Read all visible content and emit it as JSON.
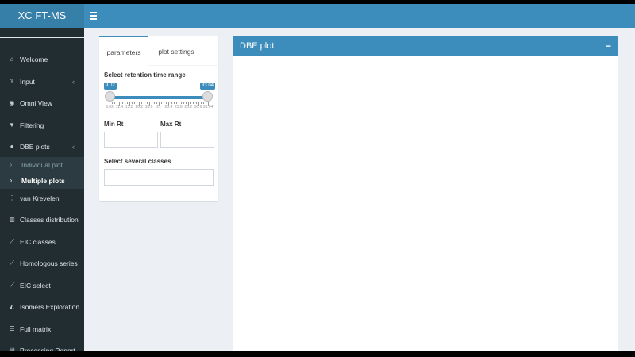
{
  "app": {
    "title": "XC FT-MS"
  },
  "sidebar": {
    "items": [
      {
        "label": "Welcome",
        "icon": "home-icon"
      },
      {
        "label": "Input",
        "icon": "upload-icon",
        "has_children": true
      },
      {
        "label": "Omni View",
        "icon": "eye-icon"
      },
      {
        "label": "Filtering",
        "icon": "filter-icon"
      },
      {
        "label": "DBE plots",
        "icon": "circle-icon",
        "has_children": true
      },
      {
        "label": "Individual plot",
        "sub": true
      },
      {
        "label": "Multiple plots",
        "sub": true,
        "active": true
      },
      {
        "label": "van Krevelen",
        "icon": "vertical-dots-icon"
      },
      {
        "label": "Classes distribution",
        "icon": "bar-chart-icon"
      },
      {
        "label": "EIC classes",
        "icon": "line-chart-icon"
      },
      {
        "label": "Homologous series",
        "icon": "line-chart-icon"
      },
      {
        "label": "EIC select",
        "icon": "line-chart-icon"
      },
      {
        "label": "Isomers Exploration",
        "icon": "area-chart-icon"
      },
      {
        "label": "Full matrix",
        "icon": "list-icon"
      },
      {
        "label": "Processing Report",
        "icon": "file-icon"
      }
    ]
  },
  "panel": {
    "tabs": [
      "parameters",
      "plot settings"
    ],
    "active_tab": 0,
    "slider": {
      "label": "Select retention time range",
      "min": 9.02,
      "max": 33.04,
      "from": 9.02,
      "to": 33.04,
      "from_label": "9.02",
      "to_label": "33.04",
      "tick_labels": [
        "9.02",
        "11.4",
        "13.8",
        "16.2",
        "18.6",
        "21",
        "23.4",
        "25.8",
        "28.2",
        "30.6",
        "33.04"
      ]
    },
    "min_rt": {
      "label": "Min Rt",
      "value": ""
    },
    "max_rt": {
      "label": "Max Rt",
      "value": ""
    },
    "classes": {
      "label": "Select several classes",
      "value": ""
    }
  },
  "box": {
    "title": "DBE plot",
    "collapse_symbol": "−"
  },
  "colors": {
    "primary": "#3c8dbc",
    "header_logo": "#367fa9",
    "sidebar": "#222d32",
    "content_bg": "#ecf0f5"
  }
}
